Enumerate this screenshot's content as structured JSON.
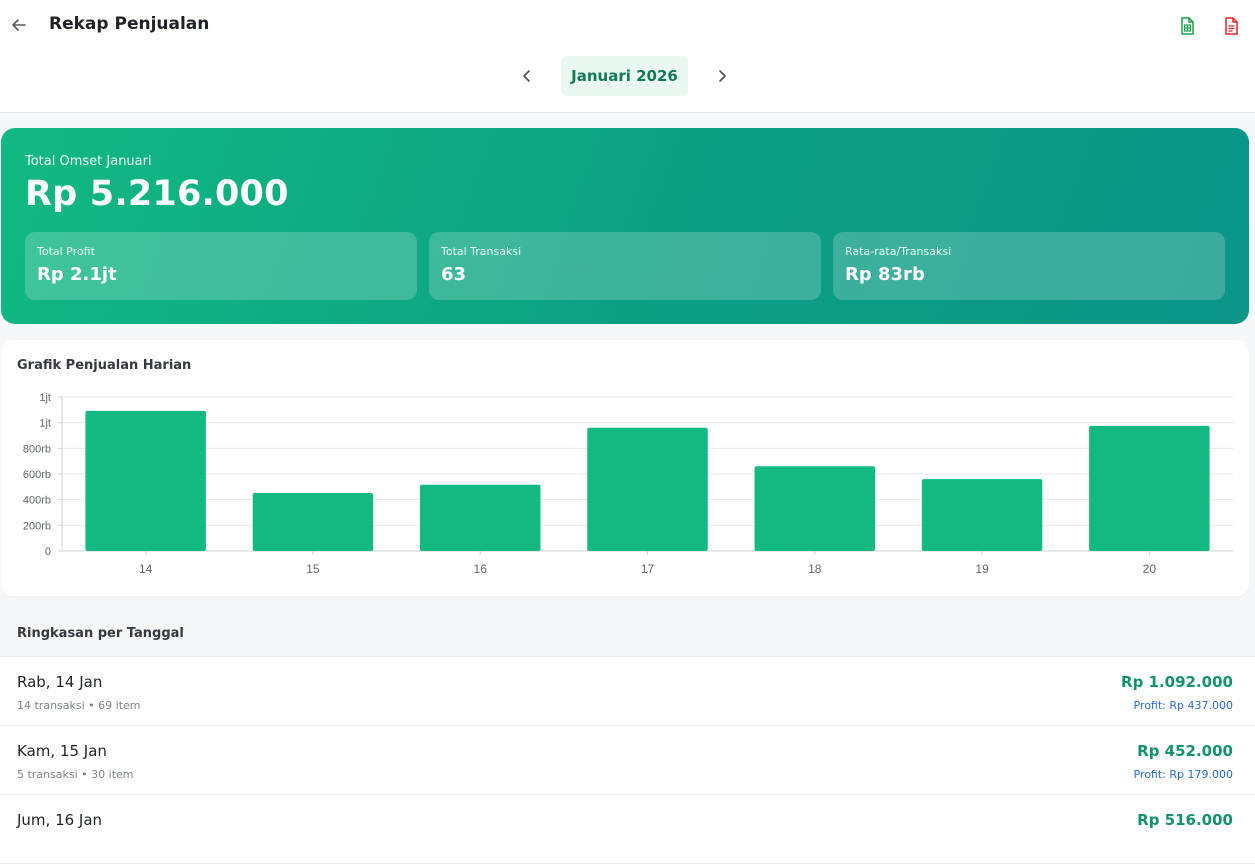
{
  "header": {
    "title": "Rekap Penjualan",
    "icons": {
      "back": "arrow-left-icon",
      "export_excel": "spreadsheet-file-icon",
      "export_pdf": "pdf-file-icon"
    },
    "colors": {
      "excel": "#17a34a",
      "pdf": "#dc2626"
    }
  },
  "month_nav": {
    "current": "Januari 2026",
    "prev_icon": "chevron-left-icon",
    "next_icon": "chevron-right-icon"
  },
  "summary": {
    "omset_label": "Total Omset Januari",
    "omset_value": "Rp 5.216.000",
    "stats": [
      {
        "label": "Total Profit",
        "value": "Rp 2.1jt"
      },
      {
        "label": "Total Transaksi",
        "value": "63"
      },
      {
        "label": "Rata-rata/Transaksi",
        "value": "Rp 83rb"
      }
    ]
  },
  "chart": {
    "title": "Grafik Penjualan Harian"
  },
  "chart_data": {
    "type": "bar",
    "categories": [
      "14",
      "15",
      "16",
      "17",
      "18",
      "19",
      "20"
    ],
    "values": [
      1092000,
      452000,
      516000,
      960000,
      660000,
      560000,
      975000
    ],
    "y_ticks": [
      "0",
      "200rb",
      "400rb",
      "600rb",
      "800rb",
      "1jt",
      "1jt"
    ],
    "ylim": [
      0,
      1200000
    ],
    "grid": true,
    "color": "#12b981"
  },
  "daily": {
    "title": "Ringkasan per Tanggal",
    "rows": [
      {
        "date": "Rab, 14 Jan",
        "meta": "14 transaksi • 69 item",
        "amount": "Rp 1.092.000",
        "profit": "Profit: Rp 437.000"
      },
      {
        "date": "Kam, 15 Jan",
        "meta": "5 transaksi • 30 item",
        "amount": "Rp 452.000",
        "profit": "Profit: Rp 179.000"
      },
      {
        "date": "Jum, 16 Jan",
        "meta": "",
        "amount": "Rp 516.000",
        "profit": ""
      }
    ]
  }
}
